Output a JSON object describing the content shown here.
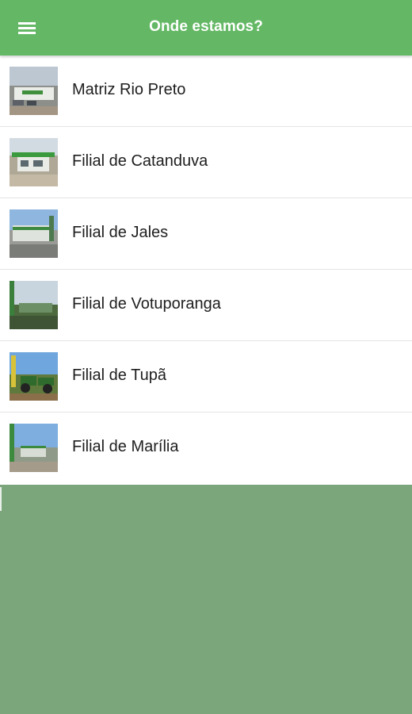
{
  "header": {
    "title": "Onde estamos?",
    "menu_icon": "menu-icon",
    "background": "#64b865"
  },
  "locations": [
    {
      "name": "Matriz Rio Preto",
      "image": "storefront-photo"
    },
    {
      "name": "Filial de Catanduva",
      "image": "storefront-photo"
    },
    {
      "name": "Filial de Jales",
      "image": "storefront-photo"
    },
    {
      "name": "Filial de Votuporanga",
      "image": "storefront-photo"
    },
    {
      "name": "Filial de Tupã",
      "image": "tractors-photo"
    },
    {
      "name": "Filial de Marília",
      "image": "storefront-photo"
    }
  ],
  "colors": {
    "app_bar": "#64b865",
    "page_background": "#7ba67c",
    "list_background": "#ffffff"
  }
}
